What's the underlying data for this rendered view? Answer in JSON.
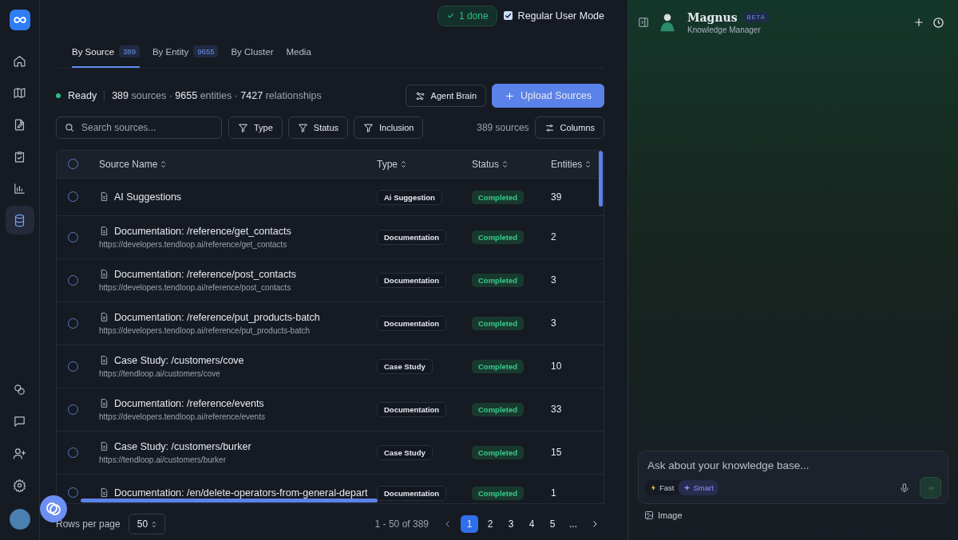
{
  "sidebar": {
    "items": [
      {
        "selected": false
      },
      {
        "selected": false
      },
      {
        "selected": false
      },
      {
        "selected": false
      },
      {
        "selected": false
      },
      {
        "selected": true
      }
    ]
  },
  "top_bar": {
    "done_badge": "1 done",
    "mode": {
      "label": "Regular User Mode",
      "checked": true
    }
  },
  "tabs": [
    {
      "label": "By Source",
      "count": "389",
      "selected": true
    },
    {
      "label": "By Entity",
      "count": "9655",
      "selected": false
    },
    {
      "label": "By Cluster",
      "selected": false
    },
    {
      "label": "Media",
      "selected": false
    }
  ],
  "status": {
    "label": "Ready",
    "stats": "**389** sources · **9655** entities · **7427** relationships"
  },
  "actions": {
    "agent_brain": "Agent Brain",
    "upload": "Upload Sources"
  },
  "search": {
    "placeholder": "Search sources..."
  },
  "filters": [
    "Type",
    "Status",
    "Inclusion"
  ],
  "source_count": "389 sources",
  "columns_button": "Columns",
  "table": {
    "all_selected": false,
    "columns": [
      "Source Name",
      "Type",
      "Status",
      "Entities"
    ],
    "rows": [
      {
        "name": "AI Suggestions",
        "type": "Ai Suggestion",
        "status": "Completed",
        "entities": "39",
        "selected": false
      },
      {
        "name": "Documentation: /reference/get_contacts",
        "url": "https://developers.tendloop.ai/reference/get_contacts",
        "type": "Documentation",
        "status": "Completed",
        "entities": "2",
        "selected": false
      },
      {
        "name": "Documentation: /reference/post_contacts",
        "url": "https://developers.tendloop.ai/reference/post_contacts",
        "type": "Documentation",
        "status": "Completed",
        "entities": "3",
        "selected": false
      },
      {
        "name": "Documentation: /reference/put_products-batch",
        "url": "https://developers.tendloop.ai/reference/put_products-batch",
        "type": "Documentation",
        "status": "Completed",
        "entities": "3",
        "selected": false
      },
      {
        "name": "Case Study: /customers/cove",
        "url": "https://tendloop.ai/customers/cove",
        "type": "Case Study",
        "status": "Completed",
        "entities": "10",
        "selected": false
      },
      {
        "name": "Documentation: /reference/events",
        "url": "https://developers.tendloop.ai/reference/events",
        "type": "Documentation",
        "status": "Completed",
        "entities": "33",
        "selected": false
      },
      {
        "name": "Case Study: /customers/burker",
        "url": "https://tendloop.ai/customers/burker",
        "type": "Case Study",
        "status": "Completed",
        "entities": "15",
        "selected": false
      },
      {
        "name": "Documentation: /en/delete-operators-from-general-depart",
        "type": "Documentation",
        "status": "Completed",
        "entities": "1",
        "selected": false
      }
    ]
  },
  "footer": {
    "rows_label": "Rows per page",
    "rows_value": "50",
    "range": "1 - 50 of 389",
    "pages": [
      {
        "label": "1",
        "selected": true
      },
      {
        "label": "2",
        "selected": false
      },
      {
        "label": "3",
        "selected": false
      },
      {
        "label": "4",
        "selected": false
      },
      {
        "label": "5",
        "selected": false
      }
    ],
    "ellipsis": "..."
  },
  "assistant": {
    "name": "Magnus",
    "badge": "BETA",
    "subtitle": "Knowledge Manager",
    "input_placeholder": "Ask about your knowledge base...",
    "modes": [
      {
        "label": "Fast",
        "selected": false
      },
      {
        "label": "Smart",
        "selected": true
      }
    ],
    "image_button": "Image"
  }
}
